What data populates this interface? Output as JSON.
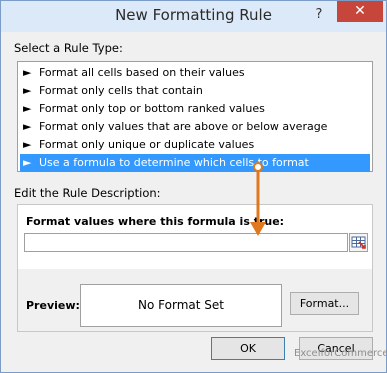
{
  "dialog": {
    "title": "New Formatting Rule",
    "help_glyph": "?",
    "close_glyph": "✕"
  },
  "rule_type": {
    "label": "Select a Rule Type:",
    "items": [
      {
        "label": "Format all cells based on their values"
      },
      {
        "label": "Format only cells that contain"
      },
      {
        "label": "Format only top or bottom ranked values"
      },
      {
        "label": "Format only values that are above or below average"
      },
      {
        "label": "Format only unique or duplicate values"
      },
      {
        "label": "Use a formula to determine which cells to format"
      }
    ],
    "selected_index": 5
  },
  "description": {
    "label": "Edit the Rule Description:",
    "formula_label": "Format values where this formula is true:",
    "formula_value": "",
    "preview_label": "Preview:",
    "preview_text": "No Format Set",
    "format_button": "Format..."
  },
  "buttons": {
    "ok": "OK",
    "cancel": "Cancel"
  },
  "watermark": "ExcelforCommerce",
  "colors": {
    "selection": "#3399ff",
    "close": "#c7463b",
    "annotation_arrow": "#e0781e"
  }
}
